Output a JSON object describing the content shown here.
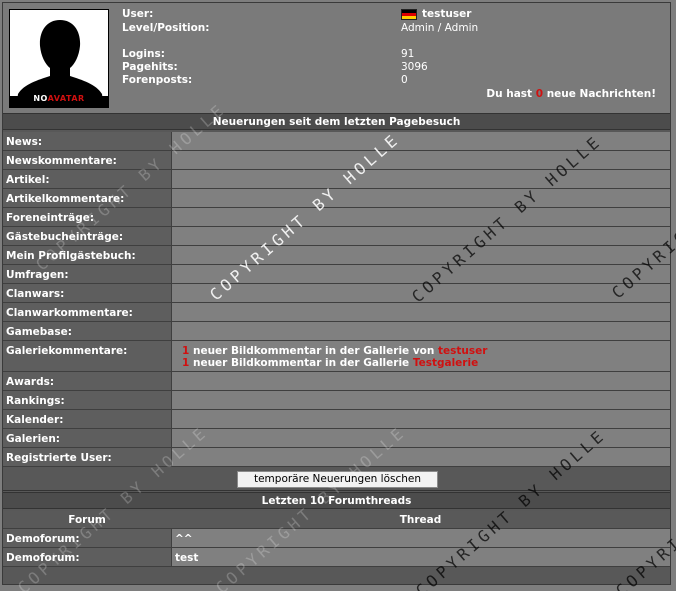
{
  "profile": {
    "avatar_label_no": "NO",
    "avatar_label_rest": "AVATAR",
    "user_label": "User:",
    "user_value": "testuser",
    "level_label": "Level/Position:",
    "level_value": "Admin / Admin",
    "logins_label": "Logins:",
    "logins_value": "91",
    "pagehits_label": "Pagehits:",
    "pagehits_value": "3096",
    "forenposts_label": "Forenposts:",
    "forenposts_value": "0",
    "messages_prefix": "Du hast",
    "messages_count": "0",
    "messages_suffix": "neue Nachrichten!",
    "flag_colors": [
      "#000000",
      "#dd0000",
      "#ffce00"
    ]
  },
  "news_section": {
    "title": "Neuerungen seit dem letzten Pagebesuch",
    "rows": [
      {
        "label": "News:"
      },
      {
        "label": "Newskommentare:"
      },
      {
        "label": "Artikel:"
      },
      {
        "label": "Artikelkommentare:"
      },
      {
        "label": "Foreneinträge:"
      },
      {
        "label": "Gästebucheinträge:"
      },
      {
        "label": "Mein Profilgästebuch:"
      },
      {
        "label": "Umfragen:"
      },
      {
        "label": "Clanwars:"
      },
      {
        "label": "Clanwarkommentare:"
      },
      {
        "label": "Gamebase:"
      },
      {
        "label": "Galeriekommentare:"
      },
      {
        "label": "Awards:"
      },
      {
        "label": "Rankings:"
      },
      {
        "label": "Kalender:"
      },
      {
        "label": "Galerien:"
      },
      {
        "label": "Registrierte User:"
      }
    ],
    "gallery_entries": [
      {
        "count": "1",
        "text": "neuer Bildkommentar in der Gallerie von",
        "link": "testuser"
      },
      {
        "count": "1",
        "text": "neuer Bildkommentar in der Gallerie",
        "link": "Testgalerie"
      }
    ],
    "clear_button": "temporäre Neuerungen löschen"
  },
  "forum_section": {
    "title": "Letzten 10 Forumthreads",
    "col_forum": "Forum",
    "col_thread": "Thread",
    "threads": [
      {
        "forum": "Demoforum:",
        "thread": "^^"
      },
      {
        "forum": "Demoforum:",
        "thread": "test"
      }
    ]
  },
  "watermark": "COPYRIGHT BY HOLLE",
  "watermark_short": "COPYRIG"
}
